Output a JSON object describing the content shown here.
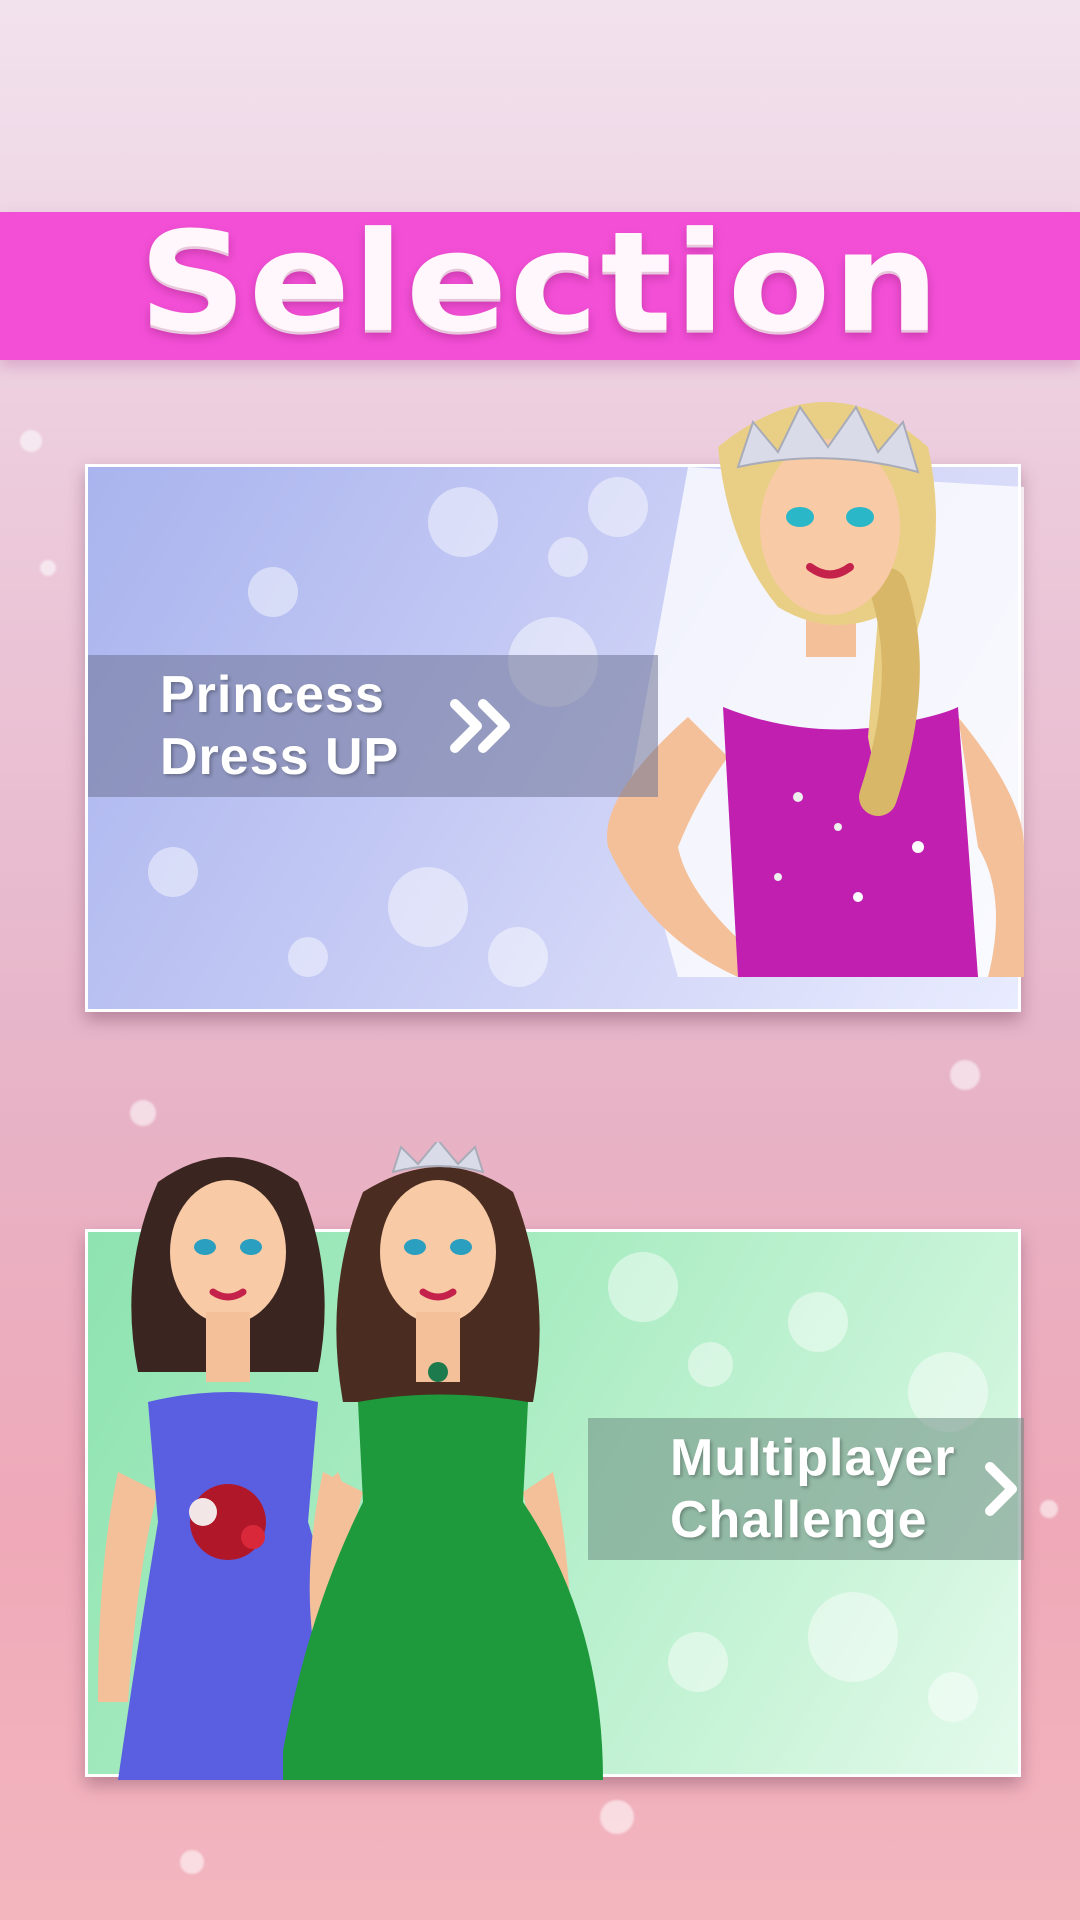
{
  "screen": {
    "title": "Selection"
  },
  "modes": [
    {
      "label_line1": "Princess",
      "label_line2": "Dress UP",
      "arrow_icon": "double-chevron-right-icon"
    },
    {
      "label_line1": "Multiplayer",
      "label_line2": "Challenge",
      "arrow_icon": "chevron-right-icon"
    }
  ],
  "colors": {
    "banner": "#f24fd6",
    "card1_bg": "#b8c0f2",
    "card2_bg": "#a9ecc2"
  }
}
